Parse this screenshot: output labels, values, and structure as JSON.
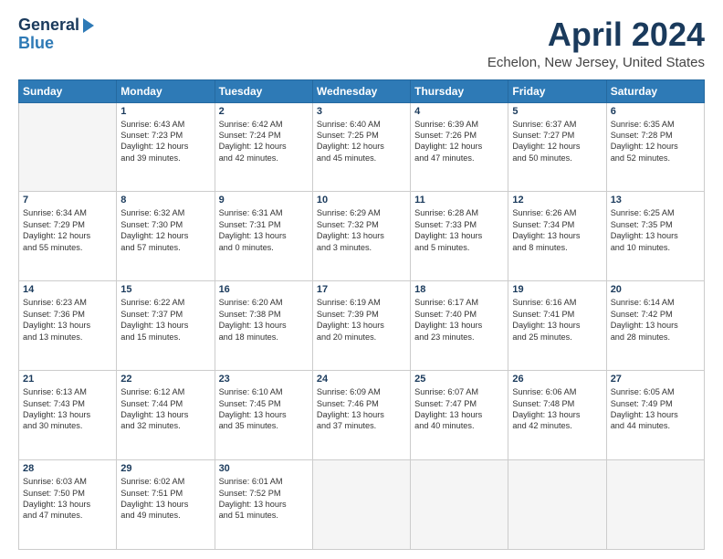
{
  "header": {
    "logo_general": "General",
    "logo_blue": "Blue",
    "month": "April 2024",
    "location": "Echelon, New Jersey, United States"
  },
  "weekdays": [
    "Sunday",
    "Monday",
    "Tuesday",
    "Wednesday",
    "Thursday",
    "Friday",
    "Saturday"
  ],
  "weeks": [
    [
      {
        "day": "",
        "data": ""
      },
      {
        "day": "1",
        "data": "Sunrise: 6:43 AM\nSunset: 7:23 PM\nDaylight: 12 hours\nand 39 minutes."
      },
      {
        "day": "2",
        "data": "Sunrise: 6:42 AM\nSunset: 7:24 PM\nDaylight: 12 hours\nand 42 minutes."
      },
      {
        "day": "3",
        "data": "Sunrise: 6:40 AM\nSunset: 7:25 PM\nDaylight: 12 hours\nand 45 minutes."
      },
      {
        "day": "4",
        "data": "Sunrise: 6:39 AM\nSunset: 7:26 PM\nDaylight: 12 hours\nand 47 minutes."
      },
      {
        "day": "5",
        "data": "Sunrise: 6:37 AM\nSunset: 7:27 PM\nDaylight: 12 hours\nand 50 minutes."
      },
      {
        "day": "6",
        "data": "Sunrise: 6:35 AM\nSunset: 7:28 PM\nDaylight: 12 hours\nand 52 minutes."
      }
    ],
    [
      {
        "day": "7",
        "data": "Sunrise: 6:34 AM\nSunset: 7:29 PM\nDaylight: 12 hours\nand 55 minutes."
      },
      {
        "day": "8",
        "data": "Sunrise: 6:32 AM\nSunset: 7:30 PM\nDaylight: 12 hours\nand 57 minutes."
      },
      {
        "day": "9",
        "data": "Sunrise: 6:31 AM\nSunset: 7:31 PM\nDaylight: 13 hours\nand 0 minutes."
      },
      {
        "day": "10",
        "data": "Sunrise: 6:29 AM\nSunset: 7:32 PM\nDaylight: 13 hours\nand 3 minutes."
      },
      {
        "day": "11",
        "data": "Sunrise: 6:28 AM\nSunset: 7:33 PM\nDaylight: 13 hours\nand 5 minutes."
      },
      {
        "day": "12",
        "data": "Sunrise: 6:26 AM\nSunset: 7:34 PM\nDaylight: 13 hours\nand 8 minutes."
      },
      {
        "day": "13",
        "data": "Sunrise: 6:25 AM\nSunset: 7:35 PM\nDaylight: 13 hours\nand 10 minutes."
      }
    ],
    [
      {
        "day": "14",
        "data": "Sunrise: 6:23 AM\nSunset: 7:36 PM\nDaylight: 13 hours\nand 13 minutes."
      },
      {
        "day": "15",
        "data": "Sunrise: 6:22 AM\nSunset: 7:37 PM\nDaylight: 13 hours\nand 15 minutes."
      },
      {
        "day": "16",
        "data": "Sunrise: 6:20 AM\nSunset: 7:38 PM\nDaylight: 13 hours\nand 18 minutes."
      },
      {
        "day": "17",
        "data": "Sunrise: 6:19 AM\nSunset: 7:39 PM\nDaylight: 13 hours\nand 20 minutes."
      },
      {
        "day": "18",
        "data": "Sunrise: 6:17 AM\nSunset: 7:40 PM\nDaylight: 13 hours\nand 23 minutes."
      },
      {
        "day": "19",
        "data": "Sunrise: 6:16 AM\nSunset: 7:41 PM\nDaylight: 13 hours\nand 25 minutes."
      },
      {
        "day": "20",
        "data": "Sunrise: 6:14 AM\nSunset: 7:42 PM\nDaylight: 13 hours\nand 28 minutes."
      }
    ],
    [
      {
        "day": "21",
        "data": "Sunrise: 6:13 AM\nSunset: 7:43 PM\nDaylight: 13 hours\nand 30 minutes."
      },
      {
        "day": "22",
        "data": "Sunrise: 6:12 AM\nSunset: 7:44 PM\nDaylight: 13 hours\nand 32 minutes."
      },
      {
        "day": "23",
        "data": "Sunrise: 6:10 AM\nSunset: 7:45 PM\nDaylight: 13 hours\nand 35 minutes."
      },
      {
        "day": "24",
        "data": "Sunrise: 6:09 AM\nSunset: 7:46 PM\nDaylight: 13 hours\nand 37 minutes."
      },
      {
        "day": "25",
        "data": "Sunrise: 6:07 AM\nSunset: 7:47 PM\nDaylight: 13 hours\nand 40 minutes."
      },
      {
        "day": "26",
        "data": "Sunrise: 6:06 AM\nSunset: 7:48 PM\nDaylight: 13 hours\nand 42 minutes."
      },
      {
        "day": "27",
        "data": "Sunrise: 6:05 AM\nSunset: 7:49 PM\nDaylight: 13 hours\nand 44 minutes."
      }
    ],
    [
      {
        "day": "28",
        "data": "Sunrise: 6:03 AM\nSunset: 7:50 PM\nDaylight: 13 hours\nand 47 minutes."
      },
      {
        "day": "29",
        "data": "Sunrise: 6:02 AM\nSunset: 7:51 PM\nDaylight: 13 hours\nand 49 minutes."
      },
      {
        "day": "30",
        "data": "Sunrise: 6:01 AM\nSunset: 7:52 PM\nDaylight: 13 hours\nand 51 minutes."
      },
      {
        "day": "",
        "data": ""
      },
      {
        "day": "",
        "data": ""
      },
      {
        "day": "",
        "data": ""
      },
      {
        "day": "",
        "data": ""
      }
    ]
  ]
}
